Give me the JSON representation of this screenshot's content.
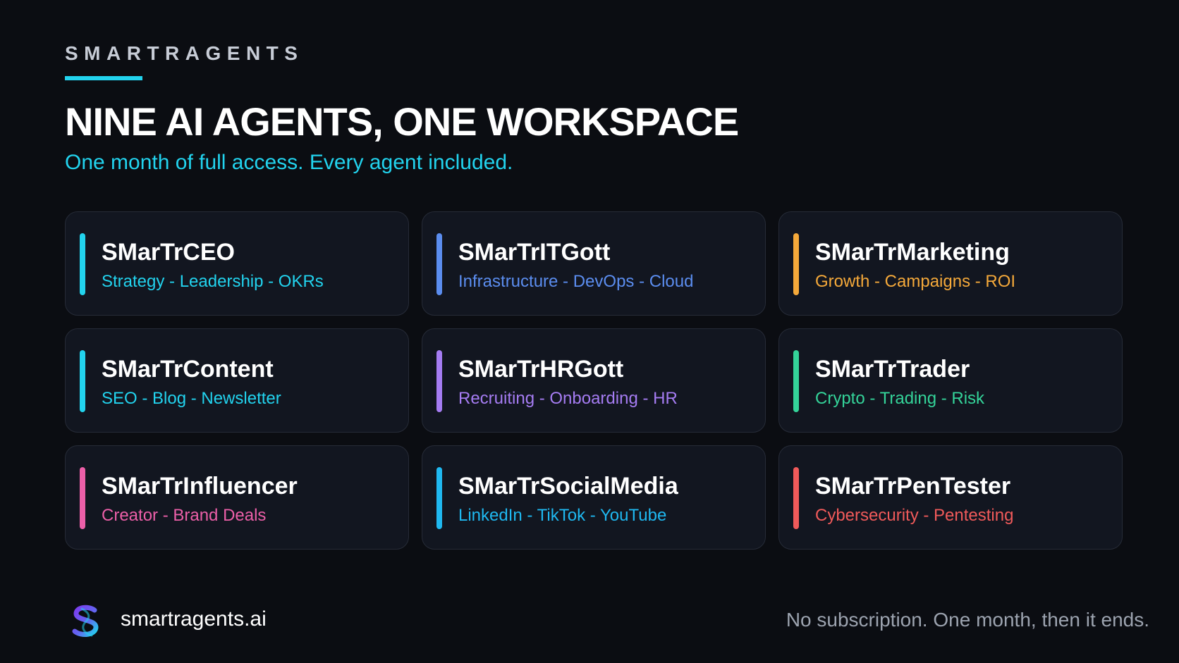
{
  "header": {
    "brand": "SMARTRAGENTS",
    "headline": "NINE AI AGENTS, ONE WORKSPACE",
    "subhead": "One month of full access. Every agent included."
  },
  "colors": {
    "background": "#0b0d12",
    "card_background": "#121620",
    "card_border": "#262b37",
    "brand_accent": "#22d3ee"
  },
  "agents": [
    {
      "name": "SMarTrCEO",
      "tags": "Strategy - Leadership - OKRs",
      "color": "#22d3ee"
    },
    {
      "name": "SMarTrITGott",
      "tags": "Infrastructure - DevOps - Cloud",
      "color": "#5b8def"
    },
    {
      "name": "SMarTrMarketing",
      "tags": "Growth - Campaigns - ROI",
      "color": "#f5a93a"
    },
    {
      "name": "SMarTrContent",
      "tags": "SEO - Blog - Newsletter",
      "color": "#22d3ee"
    },
    {
      "name": "SMarTrHRGott",
      "tags": "Recruiting - Onboarding - HR",
      "color": "#a57cf2"
    },
    {
      "name": "SMarTrTrader",
      "tags": "Crypto - Trading - Risk",
      "color": "#34d399"
    },
    {
      "name": "SMarTrInfluencer",
      "tags": "Creator - Brand Deals",
      "color": "#ec5fa8"
    },
    {
      "name": "SMarTrSocialMedia",
      "tags": "LinkedIn - TikTok - YouTube",
      "color": "#1fb8f0"
    },
    {
      "name": "SMarTrPenTester",
      "tags": "Cybersecurity - Pentesting",
      "color": "#f05a5a"
    }
  ],
  "footer": {
    "logo_icon": "smartragents-s-logo-icon",
    "site": "smartragents.ai",
    "note": "No subscription. One month, then it ends."
  }
}
